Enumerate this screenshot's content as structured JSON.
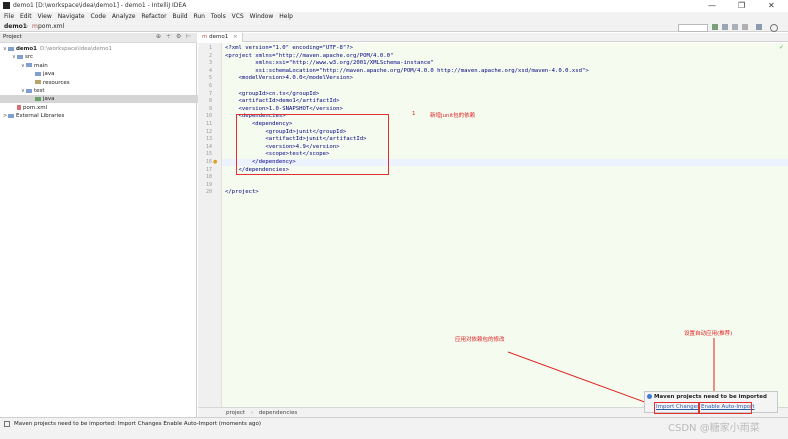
{
  "window": {
    "title": "demo1 [D:\\workspace\\idea\\demo1] - demo1 - IntelliJ IDEA",
    "minimize": "—",
    "maximize": "❐",
    "close": "✕"
  },
  "menu": [
    "File",
    "Edit",
    "View",
    "Navigate",
    "Code",
    "Analyze",
    "Refactor",
    "Build",
    "Run",
    "Tools",
    "VCS",
    "Window",
    "Help"
  ],
  "navbar": {
    "project": "demo1",
    "file": "pom.xml"
  },
  "project_panel": {
    "title": "Project",
    "tree": [
      {
        "label": "demo1",
        "extra": "D:\\workspace\\idea\\demo1",
        "depth": 0,
        "kind": "module",
        "arrow": "∨"
      },
      {
        "label": "src",
        "depth": 1,
        "kind": "folder",
        "arrow": "∨"
      },
      {
        "label": "main",
        "depth": 2,
        "kind": "folder",
        "arrow": "∨"
      },
      {
        "label": "java",
        "depth": 3,
        "kind": "folder",
        "arrow": ""
      },
      {
        "label": "resources",
        "depth": 3,
        "kind": "res",
        "arrow": ""
      },
      {
        "label": "test",
        "depth": 2,
        "kind": "folder",
        "arrow": "∨"
      },
      {
        "label": "java",
        "depth": 3,
        "kind": "src",
        "arrow": "",
        "selected": true
      },
      {
        "label": "pom.xml",
        "depth": 1,
        "kind": "file",
        "arrow": ""
      },
      {
        "label": "External Libraries",
        "depth": 0,
        "kind": "lib",
        "arrow": ">"
      }
    ]
  },
  "editor": {
    "tab": "demo1",
    "lines": [
      "<?xml version=\"1.0\" encoding=\"UTF-8\"?>",
      "<project xmlns=\"http://maven.apache.org/POM/4.0.0\"",
      "         xmlns:xsi=\"http://www.w3.org/2001/XMLSchema-instance\"",
      "         xsi:schemaLocation=\"http://maven.apache.org/POM/4.0.0 http://maven.apache.org/xsd/maven-4.0.0.xsd\">",
      "    <modelVersion>4.0.0</modelVersion>",
      "",
      "    <groupId>cn.tx</groupId>",
      "    <artifactId>demo1</artifactId>",
      "    <version>1.0-SNAPSHOT</version>",
      "    <dependencies>",
      "        <dependency>",
      "            <groupId>junit</groupId>",
      "            <artifactId>junit</artifactId>",
      "            <version>4.9</version>",
      "            <scope>test</scope>",
      "        </dependency>",
      "    </dependencies>",
      "",
      "",
      "</project>"
    ],
    "breadcrumb": [
      "project",
      "dependencies"
    ]
  },
  "annotations": {
    "num": "1",
    "a1": "新增junit包的依赖",
    "a2": "应用对依赖包的修改",
    "a3": "设置自动应用(推荐)"
  },
  "notification": {
    "title": "Maven projects need to be imported",
    "import": "Import Changes",
    "auto": "Enable Auto-Import"
  },
  "status": {
    "message": "Maven projects need to be imported: Import Changes   Enable Auto-Import (moments ago)"
  },
  "watermark": "CSDN @糖家小雨菜"
}
